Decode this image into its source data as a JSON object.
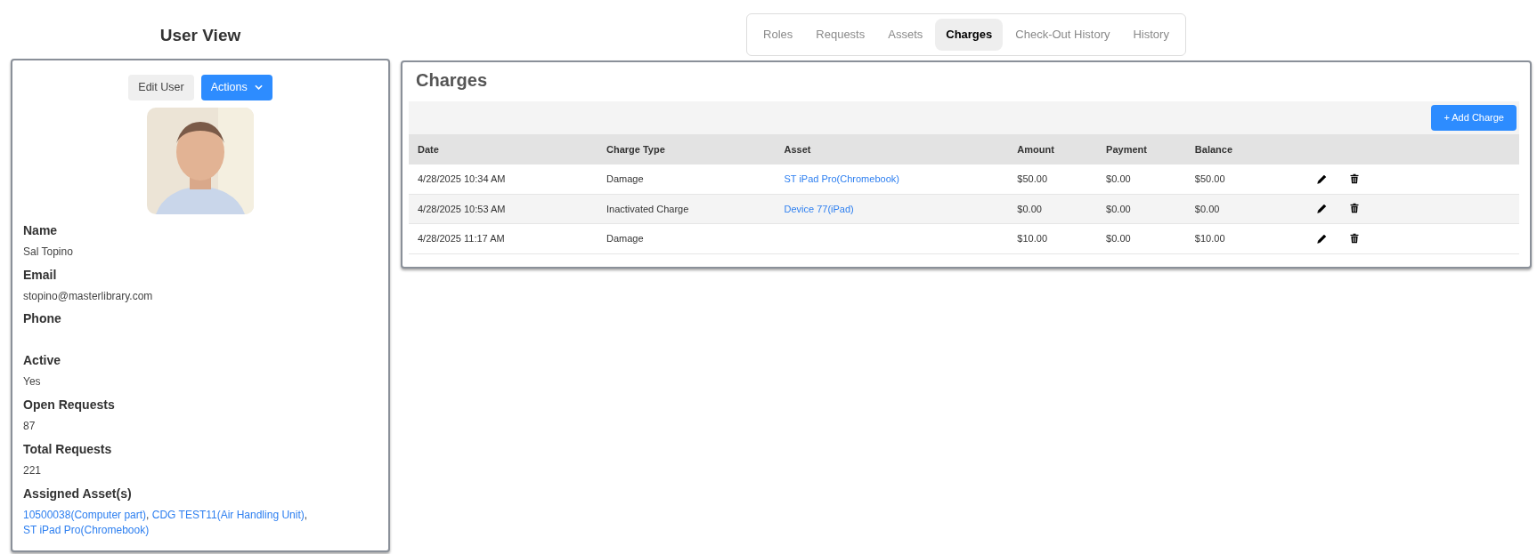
{
  "page_title": "User View",
  "tabs": [
    {
      "label": "Roles",
      "selected": false
    },
    {
      "label": "Requests",
      "selected": false
    },
    {
      "label": "Assets",
      "selected": false
    },
    {
      "label": "Charges",
      "selected": true
    },
    {
      "label": "Check-Out History",
      "selected": false
    },
    {
      "label": "History",
      "selected": false
    }
  ],
  "user_card": {
    "buttons": [
      {
        "label": "Edit User",
        "kind": "plain"
      },
      {
        "label": "Actions",
        "kind": "dropdown"
      }
    ],
    "fields": [
      {
        "label": "Name",
        "value": "Sal Topino"
      },
      {
        "label": "Email",
        "value": "stopino@masterlibrary.com"
      },
      {
        "label": "Phone"
      },
      {
        "label": "Active",
        "value": "Yes"
      },
      {
        "label": "Open Requests",
        "value": "87"
      },
      {
        "label": "Total Requests",
        "value": "221"
      },
      {
        "label": "Assigned Asset(s)",
        "separator": ",",
        "links": [
          "10500038(Computer part)",
          "CDG TEST11(Air Handling Unit)",
          "ST iPad Pro(Chromebook)"
        ]
      }
    ]
  },
  "charges": {
    "title": "Charges",
    "add_button": "+ Add Charge",
    "columns": [
      "Date",
      "Charge Type",
      "Asset",
      "Amount",
      "Payment",
      "Balance"
    ],
    "rows": [
      {
        "date": "4/28/2025 10:34 AM",
        "charge_type": "Damage",
        "asset": "ST iPad Pro(Chromebook)",
        "amount": "$50.00",
        "payment": "$0.00",
        "balance": "$50.00"
      },
      {
        "date": "4/28/2025 10:53 AM",
        "charge_type": "Inactivated Charge",
        "asset": "Device 77(iPad)",
        "amount": "$0.00",
        "payment": "$0.00",
        "balance": "$0.00"
      },
      {
        "date": "4/28/2025 11:17 AM",
        "charge_type": "Damage",
        "amount": "$10.00",
        "payment": "$0.00",
        "balance": "$10.00"
      }
    ]
  }
}
